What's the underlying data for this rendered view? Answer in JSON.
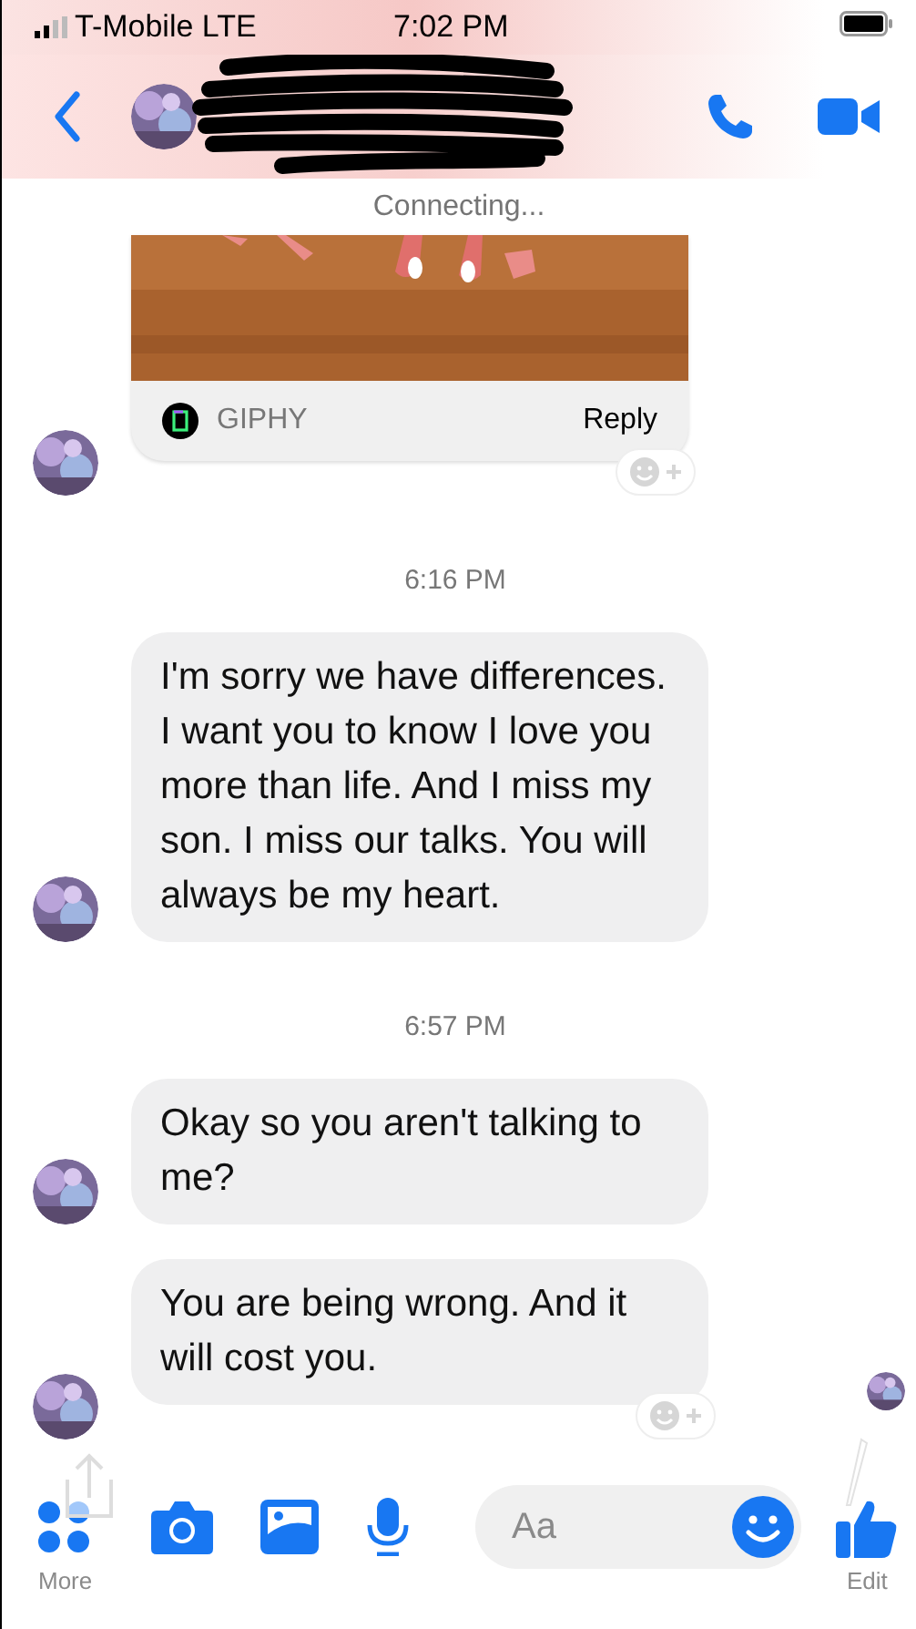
{
  "status_bar": {
    "carrier": "T-Mobile LTE",
    "time": "7:02 PM"
  },
  "connection_status": "Connecting...",
  "messages": [
    {
      "kind": "gif",
      "source": "GIPHY",
      "action": "Reply",
      "reaction_button": true
    },
    {
      "kind": "timestamp",
      "text": "6:16 PM"
    },
    {
      "kind": "text",
      "text": "I'm sorry we have differences. I want you to know I love you more than life. And I miss my son. I miss our talks. You will always be my heart.",
      "reaction_button": false
    },
    {
      "kind": "timestamp",
      "text": "6:57 PM"
    },
    {
      "kind": "text",
      "text": "Okay so you aren't talking to me?",
      "reaction_button": false
    },
    {
      "kind": "text",
      "text": "You are being wrong. And it will cost you.",
      "reaction_button": true
    }
  ],
  "composer": {
    "placeholder": "Aa",
    "more_label": "More",
    "edit_label": "Edit"
  }
}
